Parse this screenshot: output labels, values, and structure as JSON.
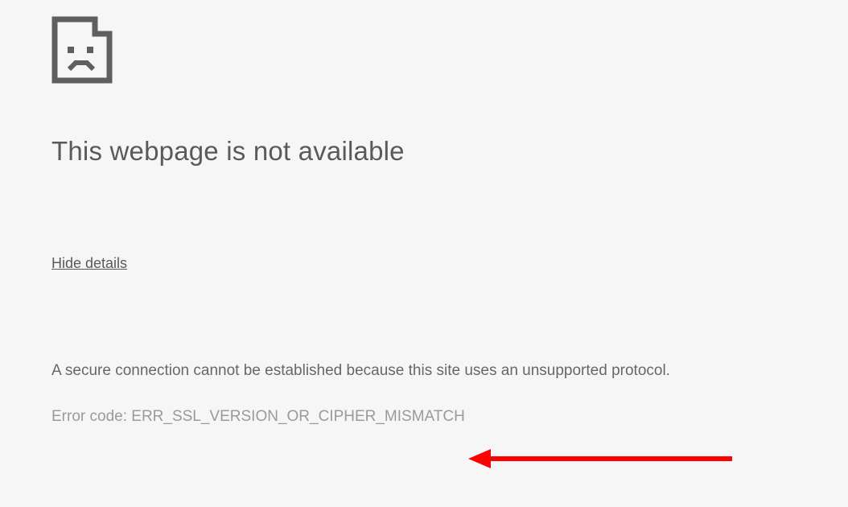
{
  "page": {
    "heading": "This webpage is not available",
    "toggle_label": "Hide details",
    "description": "A secure connection cannot be established because this site uses an unsupported protocol.",
    "error_code_label": "Error code: ",
    "error_code_value": "ERR_SSL_VERSION_OR_CIPHER_MISMATCH",
    "icon_name": "sad-page-icon",
    "annotation": {
      "type": "arrow",
      "color": "#ff0000"
    }
  }
}
